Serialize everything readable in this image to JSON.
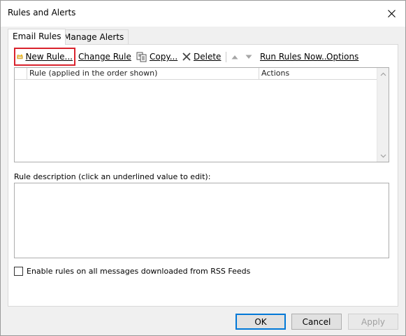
{
  "window": {
    "title": "Rules and Alerts"
  },
  "tabs": [
    {
      "label": "Email Rules",
      "active": true
    },
    {
      "label": "Manage Alerts",
      "active": false
    }
  ],
  "toolbar": {
    "new_rule": {
      "label": "New Rule...",
      "icon": "folder-new-icon"
    },
    "change_rule": {
      "label": "Change Rule",
      "icon": "chevron-down-icon"
    },
    "copy": {
      "label": "Copy...",
      "icon": "copy-icon"
    },
    "delete": {
      "label": "Delete",
      "icon": "delete-x-icon"
    },
    "move_up": {
      "icon": "arrow-up-icon"
    },
    "move_down": {
      "icon": "arrow-down-icon"
    },
    "run_rules": {
      "label": "Run Rules Now..."
    },
    "options": {
      "label": "Options"
    },
    "highlight_color": "#d9232d"
  },
  "rules_table": {
    "columns": [
      "Rule (applied in the order shown)",
      "Actions"
    ],
    "rows": []
  },
  "description": {
    "label": "Rule description (click an underlined value to edit):",
    "text": ""
  },
  "rss_option": {
    "label": "Enable rules on all messages downloaded from RSS Feeds",
    "checked": false
  },
  "buttons": {
    "ok": "OK",
    "cancel": "Cancel",
    "apply": "Apply"
  },
  "colors": {
    "focus_border": "#0078d7",
    "window_bg": "#f0f0f0"
  }
}
